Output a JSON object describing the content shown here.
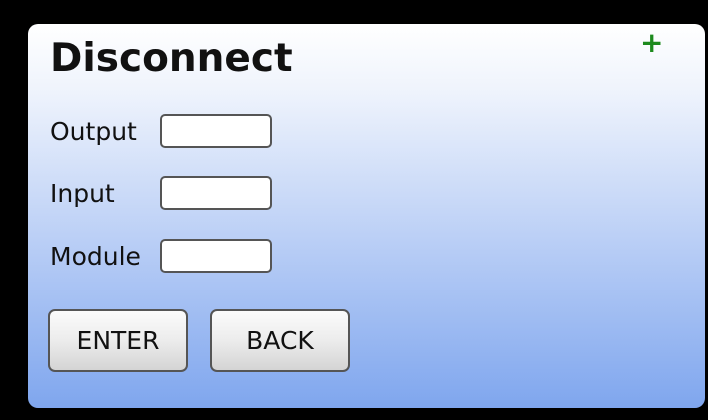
{
  "dialog": {
    "title": "Disconnect",
    "add_icon_glyph": "+",
    "add_icon_color": "#1d8a1d"
  },
  "fields": [
    {
      "label": "Output",
      "value": ""
    },
    {
      "label": "Input",
      "value": ""
    },
    {
      "label": "Module",
      "value": ""
    }
  ],
  "buttons": {
    "enter_label": "ENTER",
    "back_label": "BACK"
  },
  "colors": {
    "background": "#000000",
    "panel_top": "#ffffff",
    "panel_bottom": "#7fa6ee"
  }
}
